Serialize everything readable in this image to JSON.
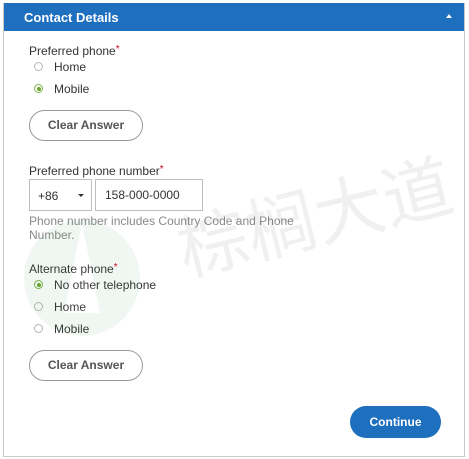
{
  "header": {
    "title": "Contact Details",
    "collapse_icon": "chevron-up-icon"
  },
  "preferred_phone": {
    "label": "Preferred phone",
    "required_mark": "*",
    "options": [
      {
        "label": "Home",
        "checked": false
      },
      {
        "label": "Mobile",
        "checked": true
      }
    ],
    "clear_label": "Clear Answer"
  },
  "phone_number": {
    "label": "Preferred phone number",
    "required_mark": "*",
    "country_code": "+86",
    "value": "158-000-0000",
    "help": "Phone number includes Country Code and Phone Number."
  },
  "alternate_phone": {
    "label": "Alternate phone",
    "required_mark": "*",
    "options": [
      {
        "label": "No other telephone",
        "checked": true
      },
      {
        "label": "Home",
        "checked": false
      },
      {
        "label": "Mobile",
        "checked": false
      }
    ],
    "clear_label": "Clear Answer"
  },
  "footer": {
    "continue_label": "Continue"
  },
  "watermark": {
    "text": "棕榈大道"
  },
  "colors": {
    "accent": "#1f6fbf",
    "radio_checked": "#6aa62d",
    "required": "#d0021b"
  }
}
